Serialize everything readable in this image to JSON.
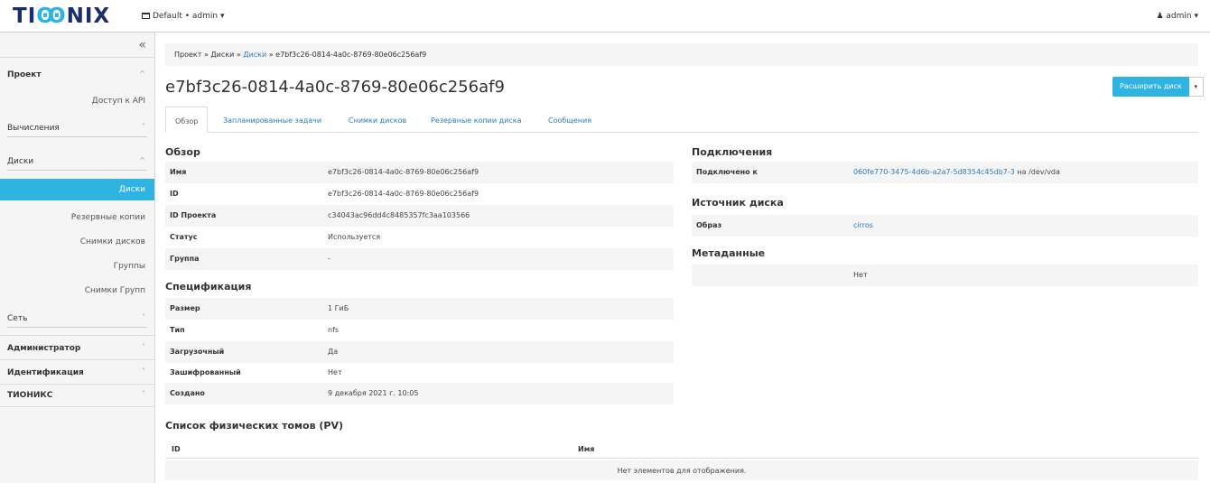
{
  "header": {
    "logo_text_1": "TI",
    "logo_text_2": "Ꙭ",
    "logo_text_3": "NIX",
    "context": "Default • admin ▾",
    "user": "admin ▾"
  },
  "sidebar": {
    "collapse_glyph": "«",
    "items": [
      {
        "label": "Проект",
        "chev": "^"
      },
      {
        "label": "Доступ к API"
      },
      {
        "label": "Вычисления",
        "chev": "˅"
      },
      {
        "label": "Диски",
        "chev": "^"
      },
      {
        "label": "Диски"
      },
      {
        "label": "Резервные копии"
      },
      {
        "label": "Снимки дисков"
      },
      {
        "label": "Группы"
      },
      {
        "label": "Снимки Групп"
      },
      {
        "label": "Сеть",
        "chev": "˅"
      },
      {
        "label": "Администратор",
        "chev": "˅"
      },
      {
        "label": "Идентификация",
        "chev": "˅"
      },
      {
        "label": "ТИОНИКС",
        "chev": "˅"
      }
    ]
  },
  "breadcrumb": {
    "p1": "Проект",
    "sep": " » ",
    "p2": "Диски",
    "p3": "Диски",
    "p4": "e7bf3c26-0814-4a0c-8769-80e06c256af9"
  },
  "page_title": "e7bf3c26-0814-4a0c-8769-80e06c256af9",
  "actions": {
    "extend_label": "Расширить диск",
    "caret": "▾"
  },
  "tabs": [
    "Обзор",
    "Запланированные задачи",
    "Снимки дисков",
    "Резервные копии диска",
    "Сообщения"
  ],
  "overview": {
    "title": "Обзор",
    "rows": [
      {
        "k": "Имя",
        "v": "e7bf3c26-0814-4a0c-8769-80e06c256af9"
      },
      {
        "k": "ID",
        "v": "e7bf3c26-0814-4a0c-8769-80e06c256af9"
      },
      {
        "k": "ID Проекта",
        "v": "c34043ac96dd4c8485357fc3aa103566"
      },
      {
        "k": "Статус",
        "v": "Используется"
      },
      {
        "k": "Группа",
        "v": "-"
      }
    ]
  },
  "spec": {
    "title": "Спецификация",
    "rows": [
      {
        "k": "Размер",
        "v": "1 ГиБ"
      },
      {
        "k": "Тип",
        "v": "nfs"
      },
      {
        "k": "Загрузочный",
        "v": "Да"
      },
      {
        "k": "Зашифрованный",
        "v": "Нет"
      },
      {
        "k": "Создано",
        "v": "9 декабря 2021 г. 10:05"
      }
    ]
  },
  "connections": {
    "title": "Подключения",
    "k": "Подключено к",
    "link": "060fe770-3475-4d6b-a2a7-5d8354c45db7-3",
    "suffix": " на /dev/vda"
  },
  "source": {
    "title": "Источник диска",
    "k": "Образ",
    "link": "cirros"
  },
  "metadata": {
    "title": "Метаданные",
    "value": "Нет"
  },
  "pv": {
    "title": "Список физических томов (PV)",
    "col_id": "ID",
    "col_name": "Имя",
    "empty": "Нет элементов для отображения."
  }
}
